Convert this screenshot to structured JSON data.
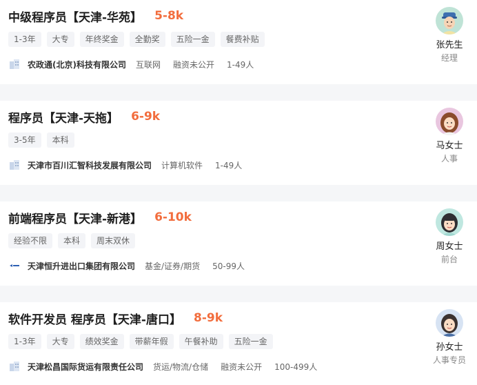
{
  "jobs": [
    {
      "title": "中级程序员【天津-华苑】",
      "salary": "5-8k",
      "tags": [
        "1-3年",
        "大专",
        "年终奖金",
        "全勤奖",
        "五险一金",
        "餐费补贴"
      ],
      "company": "农政通(北京)科技有限公司",
      "meta": [
        "互联网",
        "融资未公开",
        "1-49人"
      ],
      "recruiter": {
        "name": "张先生",
        "role": "经理"
      }
    },
    {
      "title": "程序员【天津-天拖】",
      "salary": "6-9k",
      "tags": [
        "3-5年",
        "本科"
      ],
      "company": "天津市百川汇智科技发展有限公司",
      "meta": [
        "计算机软件",
        "1-49人"
      ],
      "recruiter": {
        "name": "马女士",
        "role": "人事"
      }
    },
    {
      "title": "前端程序员【天津-新港】",
      "salary": "6-10k",
      "tags": [
        "经验不限",
        "本科",
        "周末双休"
      ],
      "company": "天津恒升进出口集团有限公司",
      "meta": [
        "基金/证券/期货",
        "50-99人"
      ],
      "recruiter": {
        "name": "周女士",
        "role": "前台"
      }
    },
    {
      "title": "软件开发员 程序员【天津-唐口】",
      "salary": "8-9k",
      "tags": [
        "1-3年",
        "大专",
        "绩效奖金",
        "带薪年假",
        "午餐补助",
        "五险一金"
      ],
      "company": "天津松昌国际货运有限责任公司",
      "meta": [
        "货运/物流/仓储",
        "融资未公开",
        "100-499人"
      ],
      "recruiter": {
        "name": "孙女士",
        "role": "人事专员"
      }
    }
  ]
}
